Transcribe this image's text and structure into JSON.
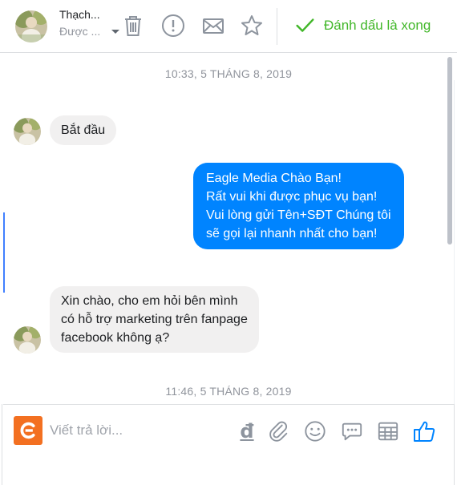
{
  "header": {
    "user_name": "Thạch...",
    "user_status": "Được ...",
    "done_label": "Đánh dấu là xong",
    "actions": [
      "trash-icon",
      "report-icon",
      "mail-icon",
      "star-icon"
    ]
  },
  "thread": {
    "timestamps": [
      "10:33, 5 THÁNG 8, 2019",
      "11:46, 5 THÁNG 8, 2019"
    ],
    "messages": [
      {
        "direction": "incoming",
        "lines": [
          "Bắt đầu"
        ]
      },
      {
        "direction": "outgoing",
        "lines": [
          "Eagle Media Chào Bạn!",
          "Rất vui khi được phục vụ bạn!",
          "Vui lòng gửi Tên+SĐT Chúng tôi",
          "sẽ gọi lại nhanh nhất cho bạn!"
        ]
      },
      {
        "direction": "incoming",
        "lines": [
          "Xin chào, cho em hỏi bên mình",
          "có hỗ trợ marketing trên fanpage",
          "facebook không ạ?"
        ]
      }
    ]
  },
  "composer": {
    "placeholder": "Viết trả lời...",
    "currency_glyph": "đ",
    "tools": [
      "attachment-icon",
      "emoji-icon",
      "saved-replies-icon",
      "table-icon",
      "like-icon"
    ]
  },
  "colors": {
    "outgoing_bubble": "#0084ff",
    "incoming_bubble": "#f1f0f0",
    "done_green": "#42b72a",
    "logo_orange": "#f37021"
  }
}
